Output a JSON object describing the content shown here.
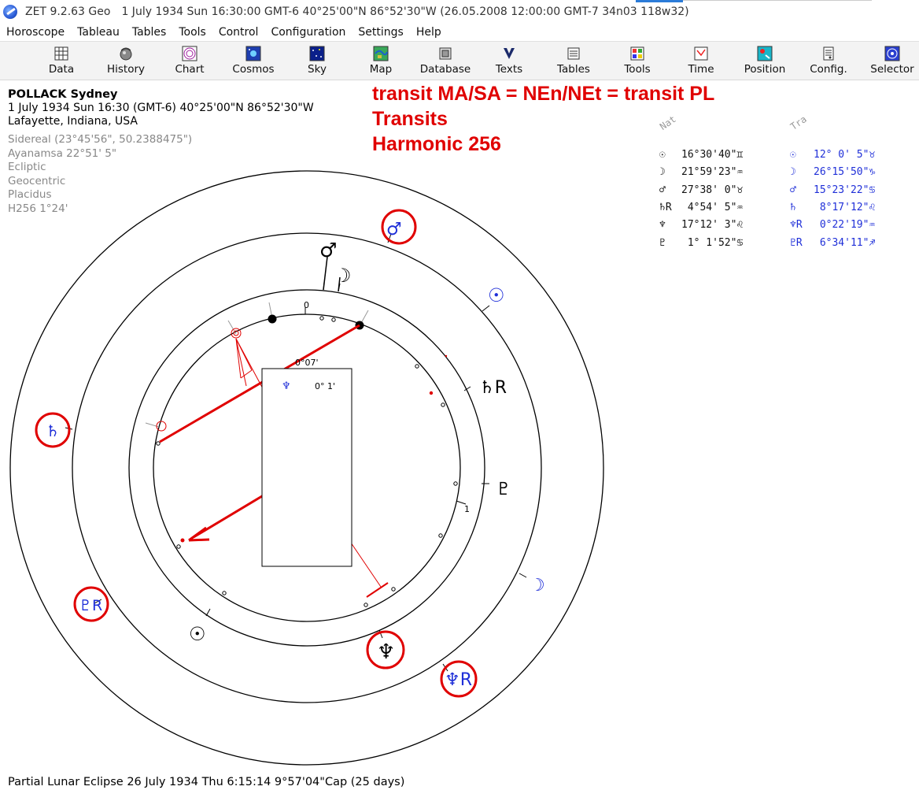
{
  "window": {
    "app_title": "ZET 9.2.63 Geo",
    "title_info": "1 July 1934  Sun  16:30:00 GMT-6 40°25'00\"N  86°52'30\"W  (26.05.2008  12:00:00 GMT-7 34n03 118w32)"
  },
  "menu": [
    {
      "label": "Horoscope"
    },
    {
      "label": "Tableau"
    },
    {
      "label": "Tables"
    },
    {
      "label": "Tools"
    },
    {
      "label": "Control"
    },
    {
      "label": "Configuration"
    },
    {
      "label": "Settings"
    },
    {
      "label": "Help"
    }
  ],
  "toolbar": [
    {
      "label": "Data",
      "icon": "data-icon"
    },
    {
      "label": "History",
      "icon": "history-icon"
    },
    {
      "label": "Chart",
      "icon": "chart-icon"
    },
    {
      "label": "Cosmos",
      "icon": "cosmos-icon"
    },
    {
      "label": "Sky",
      "icon": "sky-icon"
    },
    {
      "label": "Map",
      "icon": "map-icon"
    },
    {
      "label": "Database",
      "icon": "database-icon"
    },
    {
      "label": "Texts",
      "icon": "texts-icon"
    },
    {
      "label": "Tables",
      "icon": "tables-icon"
    },
    {
      "label": "Tools",
      "icon": "tools-icon"
    },
    {
      "label": "Time",
      "icon": "time-icon"
    },
    {
      "label": "Position",
      "icon": "position-icon"
    },
    {
      "label": "Config.",
      "icon": "config-icon"
    },
    {
      "label": "Selector",
      "icon": "selector-icon"
    }
  ],
  "info": {
    "name": "POLLACK Sydney",
    "datetime": "1 July 1934  Sun  16:30 (GMT-6) 40°25'00\"N  86°52'30\"W",
    "place": "Lafayette, Indiana, USA",
    "settings": [
      "Sidereal (23°45'56\", 50.2388475\")",
      "Ayanamsa 22°51' 5\"",
      "Ecliptic",
      "Geocentric",
      "Placidus",
      "H256   1°24'"
    ]
  },
  "annotations": [
    "transit MA/SA = NEn/NEt = transit PL",
    "Transits",
    "Harmonic 256"
  ],
  "positions": {
    "natal_header": "Nat",
    "transit_header": "Tra",
    "natal": [
      {
        "planet": "☉",
        "pos": "16°30'40\"",
        "sign": "♊"
      },
      {
        "planet": "☽",
        "pos": "21°59'23\"",
        "sign": "♒"
      },
      {
        "planet": "♂",
        "pos": "27°38' 0\"",
        "sign": "♉"
      },
      {
        "planet": "♄R",
        "pos": " 4°54' 5\"",
        "sign": "♒"
      },
      {
        "planet": "♆",
        "pos": "17°12' 3\"",
        "sign": "♌"
      },
      {
        "planet": "♇",
        "pos": " 1° 1'52\"",
        "sign": "♋"
      }
    ],
    "transit": [
      {
        "planet": "☉",
        "pos": "12° 0' 5\"",
        "sign": "♉"
      },
      {
        "planet": "☽",
        "pos": "26°15'50\"",
        "sign": "♑"
      },
      {
        "planet": "♂",
        "pos": "15°23'22\"",
        "sign": "♋"
      },
      {
        "planet": "♄",
        "pos": " 8°17'12\"",
        "sign": "♌"
      },
      {
        "planet": "♆R",
        "pos": " 0°22'19\"",
        "sign": "♒"
      },
      {
        "planet": "♇R",
        "pos": " 6°34'11\"",
        "sign": "♐"
      }
    ]
  },
  "chart": {
    "center_box_top": "0°07'",
    "center_box_neptune": "♆",
    "center_box_value": "0° 1'",
    "tick_0": "0",
    "tick_1": "1",
    "natal_glyphs": {
      "mars": "♂",
      "moon": "☽",
      "saturn": "♄R",
      "pluto": "♇",
      "neptune": "♆",
      "sun": "☉"
    },
    "transit_glyphs": {
      "mars": "♂",
      "sun": "☉",
      "moon": "☽",
      "saturn": "♄",
      "pluto": "♇R",
      "neptune": "♆R"
    },
    "colors": {
      "natal": "#000000",
      "transit": "#1f2fd8",
      "highlight": "#e00000"
    }
  },
  "status": "Partial Lunar Eclipse 26 July 1934 Thu  6:15:14  9°57'04\"Cap (25 days)"
}
